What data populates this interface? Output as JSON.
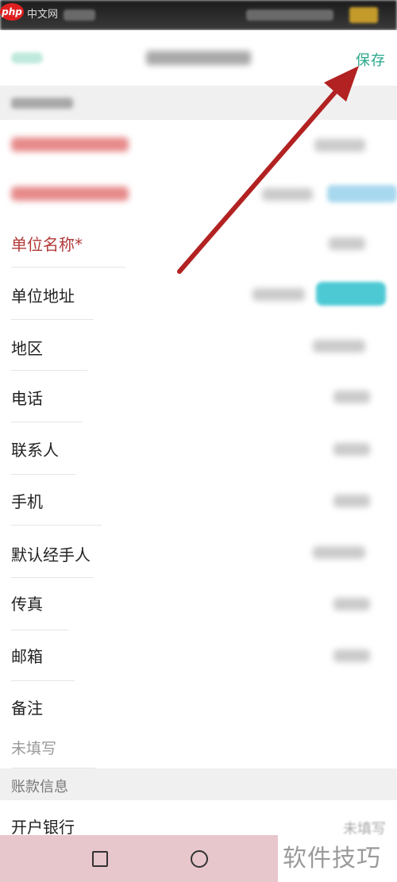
{
  "status_bar": {
    "logo_text": "php",
    "site_text": "中文网"
  },
  "header": {
    "save_label": "保存"
  },
  "form": {
    "fields": [
      {
        "label": "单位名称*"
      },
      {
        "label": "单位地址"
      },
      {
        "label": "地区"
      },
      {
        "label": "电话"
      },
      {
        "label": "联系人"
      },
      {
        "label": "手机"
      },
      {
        "label": "默认经手人"
      },
      {
        "label": "传真"
      },
      {
        "label": "邮箱"
      },
      {
        "label": "备注",
        "placeholder": "未填写"
      }
    ],
    "account_section": {
      "title": "账款信息",
      "fields": [
        {
          "label": "开户银行",
          "value": "未填写"
        }
      ]
    }
  },
  "watermark": "软件技巧",
  "colors": {
    "accent": "#2aa78c",
    "required": "#b23a3a",
    "arrow": "#b22222"
  }
}
